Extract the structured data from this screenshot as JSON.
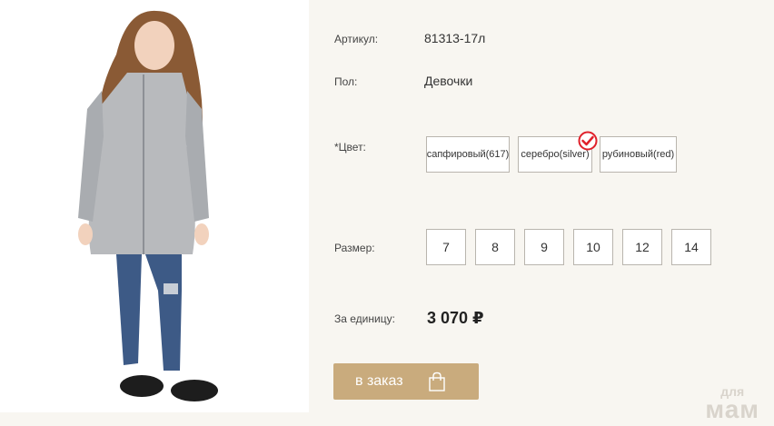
{
  "product": {
    "article_label": "Артикул:",
    "article_value": "81313-17л",
    "gender_label": "Пол:",
    "gender_value": "Девочки",
    "color_label": "*Цвет:",
    "colors": [
      {
        "label": "сапфировый(617)",
        "selected": false
      },
      {
        "label": "серебро(silver)",
        "selected": true
      },
      {
        "label": "рубиновый(red)",
        "selected": false
      }
    ],
    "size_label": "Размер:",
    "sizes": [
      "7",
      "8",
      "9",
      "10",
      "12",
      "14"
    ],
    "price_label": "За единицу:",
    "price_value": "3 070 ₽"
  },
  "order_button": {
    "label": "в заказ",
    "icon": "shopping-bag-icon"
  },
  "watermark": {
    "line1": "для",
    "line2": "мам"
  },
  "colors": {
    "accent": "#c9ab7d",
    "check": "#e0202a",
    "background": "#f8f6f1"
  }
}
